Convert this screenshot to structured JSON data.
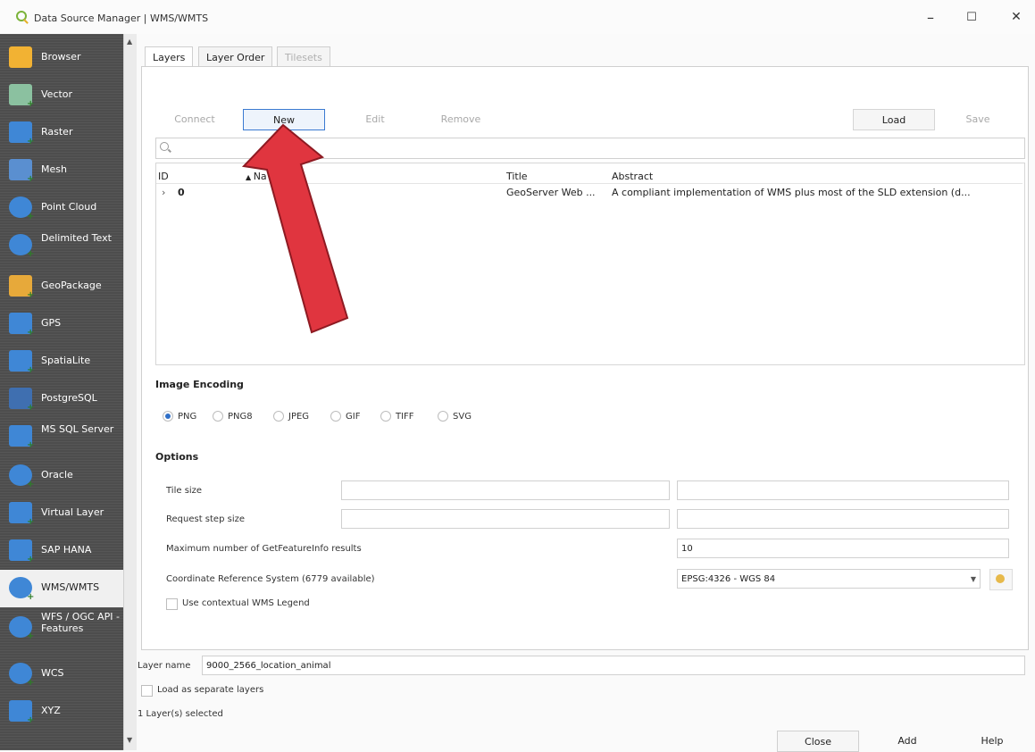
{
  "window": {
    "title": "Data Source Manager | WMS/WMTS",
    "minimize": "–",
    "maximize": "☐",
    "close": "✕"
  },
  "sidebar": {
    "items": [
      {
        "label": "Browser",
        "icon": "folder-icon",
        "color": "#f2b233"
      },
      {
        "label": "Vector",
        "icon": "vector-layer-icon",
        "color": "#8bc1a0"
      },
      {
        "label": "Raster",
        "icon": "raster-layer-icon",
        "color": "#3f87d6"
      },
      {
        "label": "Mesh",
        "icon": "mesh-layer-icon",
        "color": "#5a8fd0"
      },
      {
        "label": "Point Cloud",
        "icon": "point-cloud-icon",
        "color": "#3f87d6"
      },
      {
        "label": "Delimited Text",
        "icon": "delimited-text-icon",
        "color": "#3f87d6"
      },
      {
        "label": "GeoPackage",
        "icon": "geopackage-icon",
        "color": "#e7a93a"
      },
      {
        "label": "GPS",
        "icon": "gps-icon",
        "color": "#3f87d6"
      },
      {
        "label": "SpatiaLite",
        "icon": "spatialite-icon",
        "color": "#3f87d6"
      },
      {
        "label": "PostgreSQL",
        "icon": "postgresql-icon",
        "color": "#3f6fb0"
      },
      {
        "label": "MS SQL Server",
        "icon": "mssql-icon",
        "color": "#3f87d6"
      },
      {
        "label": "Oracle",
        "icon": "oracle-icon",
        "color": "#3f87d6"
      },
      {
        "label": "Virtual Layer",
        "icon": "virtual-layer-icon",
        "color": "#3f87d6"
      },
      {
        "label": "SAP HANA",
        "icon": "sap-hana-icon",
        "color": "#3f87d6"
      },
      {
        "label": "WMS/WMTS",
        "icon": "wms-globe-icon",
        "color": "#3f87d6"
      },
      {
        "label": "WFS / OGC API - Features",
        "icon": "wfs-globe-icon",
        "color": "#3f87d6"
      },
      {
        "label": "WCS",
        "icon": "wcs-globe-icon",
        "color": "#3f87d6"
      },
      {
        "label": "XYZ",
        "icon": "xyz-tiles-icon",
        "color": "#3f87d6"
      }
    ]
  },
  "tabs": [
    {
      "label": "Layers"
    },
    {
      "label": "Layer Order"
    },
    {
      "label": "Tilesets"
    }
  ],
  "toolbar": {
    "connect": "Connect",
    "new": "New",
    "edit": "Edit",
    "remove": "Remove",
    "load": "Load",
    "save": "Save"
  },
  "search": {
    "icon": "search-icon"
  },
  "table": {
    "headers": {
      "id": "ID",
      "name": "Na",
      "title": "Title",
      "abstract": "Abstract"
    },
    "rows": [
      {
        "id": "0",
        "title": "GeoServer Web ...",
        "abstract": "A compliant implementation of WMS plus most of the SLD extension (d..."
      }
    ]
  },
  "image_encoding": {
    "title": "Image Encoding",
    "options": [
      "PNG",
      "PNG8",
      "JPEG",
      "GIF",
      "TIFF",
      "SVG"
    ],
    "selected": "PNG"
  },
  "options": {
    "title": "Options",
    "tile_size_label": "Tile size",
    "request_step_label": "Request step size",
    "max_features_label": "Maximum number of GetFeatureInfo results",
    "max_features_value": "10",
    "crs_label": "Coordinate Reference System (6779 available)",
    "crs_value": "EPSG:4326 - WGS 84",
    "legend_label": "Use contextual WMS Legend"
  },
  "footer": {
    "layer_name_label": "Layer name",
    "layer_name_value": "9000_2566_location_animal",
    "separate_label": "Load as separate layers",
    "status": "1 Layer(s) selected",
    "close": "Close",
    "add": "Add",
    "help": "Help"
  },
  "annotation": {
    "arrow_color": "#e0353f"
  }
}
